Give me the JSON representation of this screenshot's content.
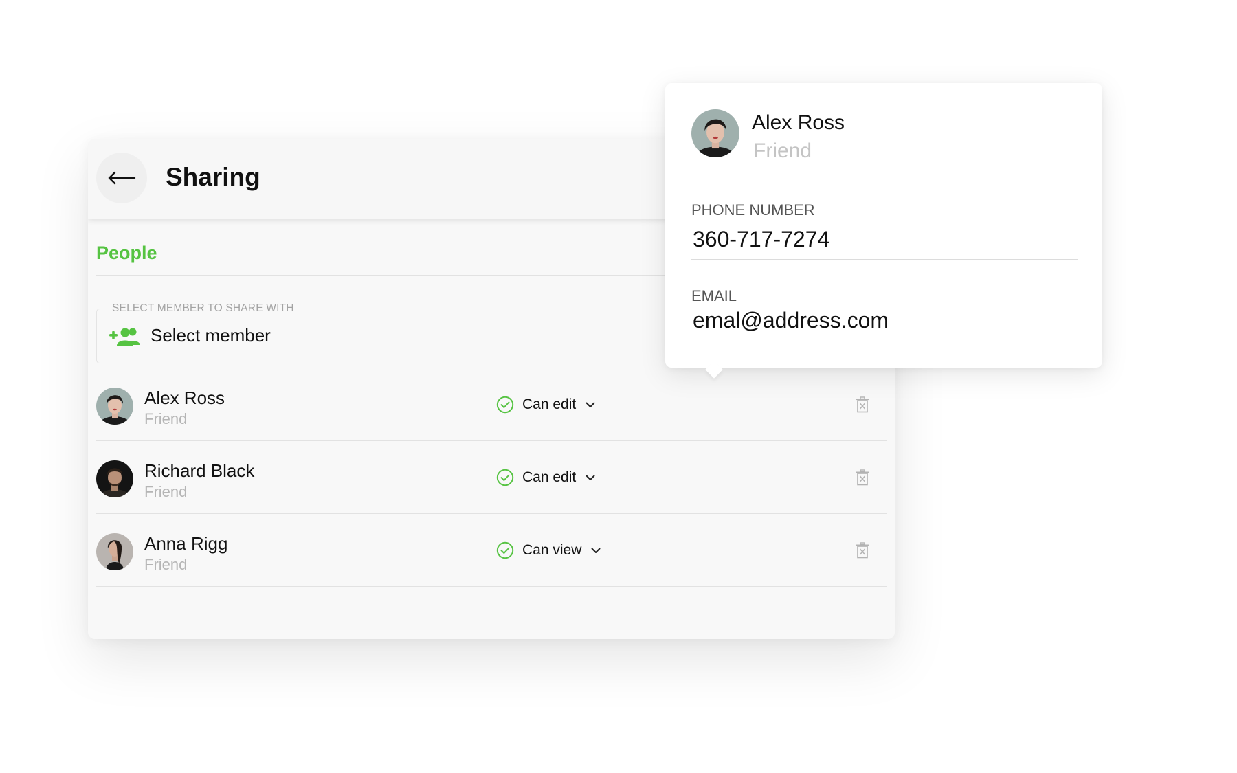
{
  "colors": {
    "accent": "#56c342",
    "text": "#111111",
    "muted": "#b5b5b5"
  },
  "header": {
    "back_icon": "arrow-left-icon",
    "title": "Sharing"
  },
  "people_section": {
    "title": "People"
  },
  "member_select": {
    "legend": "SELECT MEMBER TO SHARE WITH",
    "icon": "add-group-icon",
    "value": "Select member"
  },
  "members": [
    {
      "name": "Alex Ross",
      "role": "Friend",
      "permission": "Can edit",
      "permission_icon": "check-circle-icon",
      "delete_icon": "trash-icon"
    },
    {
      "name": "Richard Black",
      "role": "Friend",
      "permission": "Can edit",
      "permission_icon": "check-circle-icon",
      "delete_icon": "trash-icon"
    },
    {
      "name": "Anna Rigg",
      "role": "Friend",
      "permission": "Can view",
      "permission_icon": "check-circle-icon",
      "delete_icon": "trash-icon"
    }
  ],
  "contact_card": {
    "name": "Alex Ross",
    "role": "Friend",
    "phone_label": "PHONE NUMBER",
    "phone": "360-717-7274",
    "email_label": "EMAIL",
    "email": "emal@address.com"
  }
}
